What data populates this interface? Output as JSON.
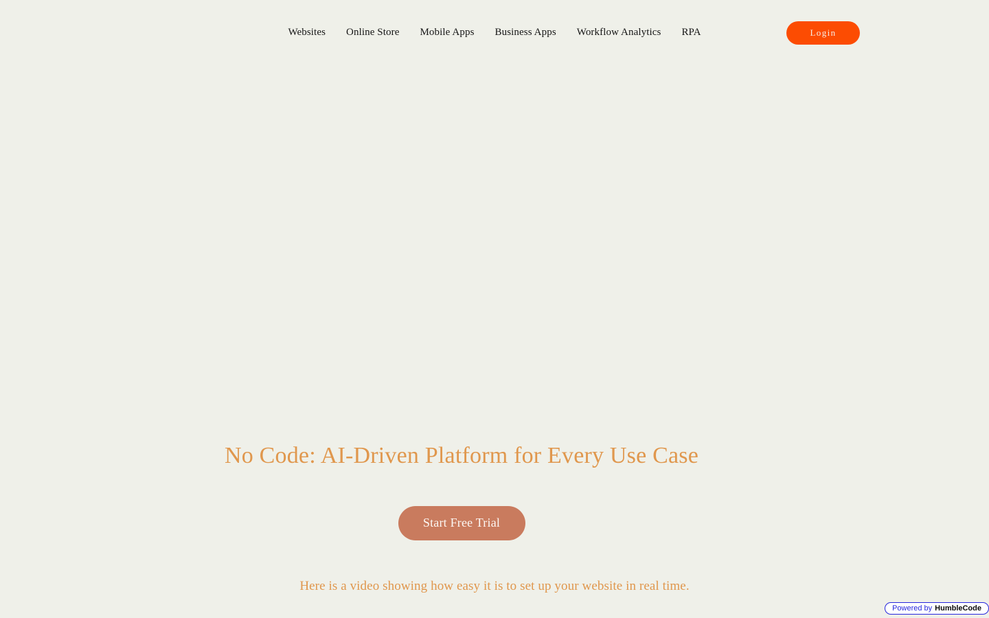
{
  "theme": {
    "page_background": "#eff0e9",
    "accent_orange": "#e0974d",
    "login_button_color": "#fc4c02",
    "cta_button_color": "#c97b5e",
    "nav_text_color": "#161616",
    "badge_blue": "#2626dd"
  },
  "header": {
    "nav": [
      {
        "label": "Websites"
      },
      {
        "label": "Online Store"
      },
      {
        "label": "Mobile Apps"
      },
      {
        "label": "Business Apps"
      },
      {
        "label": "Workflow Analytics"
      },
      {
        "label": "RPA"
      }
    ],
    "login_label": "Login"
  },
  "hero": {
    "title": "No Code: AI-Driven Platform for Every Use Case",
    "cta_label": "Start Free Trial",
    "subtitle": "Here is a video showing how easy it is to set up your website in real time."
  },
  "badge": {
    "prefix": "Powered by",
    "brand": "HumbleCode"
  }
}
